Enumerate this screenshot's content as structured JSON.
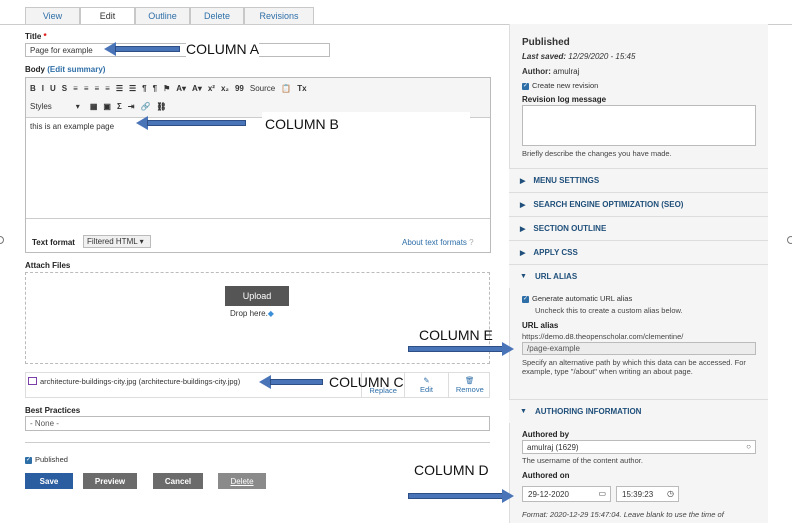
{
  "tabs": [
    "View",
    "Edit",
    "Outline",
    "Delete",
    "Revisions"
  ],
  "title": {
    "label": "Title",
    "required_mark": "*",
    "value": "Page for example"
  },
  "body": {
    "label": "Body",
    "edit_summary": "(Edit summary)",
    "toolbar_row1": [
      "B",
      "I",
      "U",
      "S",
      "≡",
      "≡",
      "≡",
      "≡",
      "☰",
      "☰",
      "¶",
      "¶",
      "|",
      "A▾",
      "A▾",
      "x²",
      "x₂",
      "99",
      "Source",
      "Tx"
    ],
    "styles_label": "Styles",
    "content": "this is an example page",
    "text_format_label": "Text format",
    "text_format_value": "Filtered HTML",
    "about_formats": "About text formats"
  },
  "attach": {
    "label": "Attach Files",
    "upload_button": "Upload",
    "drop_text": "Drop here.",
    "file_name": "architecture-buildings-city.jpg (architecture-buildings-city.jpg)",
    "actions": [
      "Replace",
      "Edit",
      "Remove"
    ]
  },
  "best_practices": {
    "label": "Best Practices",
    "value": "- None -"
  },
  "published_checkbox": "Published",
  "buttons": {
    "save": "Save",
    "preview": "Preview",
    "cancel": "Cancel",
    "delete": "Delete"
  },
  "sidebar": {
    "status": "Published",
    "last_saved_label": "Last saved:",
    "last_saved_value": "12/29/2020 - 15:45",
    "author_label": "Author:",
    "author_value": "amulraj",
    "create_revision": "Create new revision",
    "revision_log_label": "Revision log message",
    "revision_help": "Briefly describe the changes you have made.",
    "sections": [
      "MENU SETTINGS",
      "SEARCH ENGINE OPTIMIZATION (SEO)",
      "SECTION OUTLINE",
      "APPLY CSS"
    ],
    "url_alias_title": "URL ALIAS",
    "generate_alias": "Generate automatic URL alias",
    "generate_help": "Uncheck this to create a custom alias below.",
    "url_alias_label": "URL alias",
    "url_base": "https://demo.d8.theopenscholar.com/clementine/",
    "url_value": "/page-example",
    "url_help": "Specify an alternative path by which this data can be accessed. For example, type \"/about\" when writing an about page.",
    "authoring_title": "AUTHORING INFORMATION",
    "authored_by_label": "Authored by",
    "authored_by_value": "amulraj (1629)",
    "authored_by_help": "The username of the content author.",
    "authored_on_label": "Authored on",
    "date_value": "29-12-2020",
    "time_value": "15:39:23",
    "format_help": "Format: 2020-12-29 15:47:04. Leave blank to use the time of"
  },
  "annotations": {
    "col_a": "COLUMN A",
    "col_b": "COLUMN B",
    "col_c": "COLUMN C",
    "col_d": "COLUMN D",
    "col_e": "COLUMN E"
  },
  "colors": {
    "accent": "#2f6fa8",
    "save_button": "#2a5ea0",
    "grey_button": "#6b6b6b",
    "arrow": "#4a74b8"
  }
}
